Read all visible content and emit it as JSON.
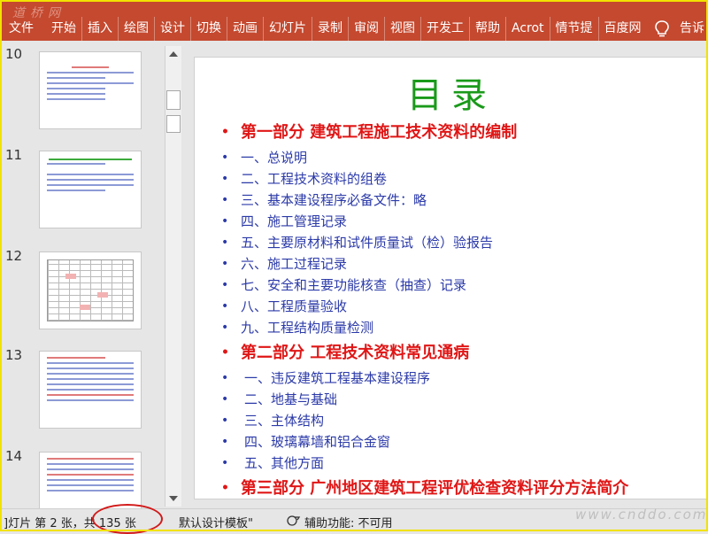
{
  "ribbon": {
    "logo": "道桥网",
    "tabs": [
      "文件",
      "开始",
      "插入",
      "绘图",
      "设计",
      "切换",
      "动画",
      "幻灯片",
      "录制",
      "审阅",
      "视图",
      "开发工",
      "帮助",
      "Acrot",
      "情节提",
      "百度网"
    ],
    "tell_me": "告诉"
  },
  "thumbnails": [
    {
      "number": "10"
    },
    {
      "number": "11"
    },
    {
      "number": "12"
    },
    {
      "number": "13"
    },
    {
      "number": "14"
    }
  ],
  "slide": {
    "title": "目录",
    "sections": [
      {
        "label": "第一部分  建筑工程施工技术资料的编制",
        "items": [
          "一、总说明",
          "二、工程技术资料的组卷",
          "三、基本建设程序必备文件：略",
          "四、施工管理记录",
          "五、主要原材料和试件质量试（检）验报告",
          "六、施工过程记录",
          "七、安全和主要功能核查（抽查）记录",
          "八、工程质量验收",
          "九、工程结构质量检测"
        ]
      },
      {
        "label": "第二部分  工程技术资料常见通病",
        "items": [
          "一、违反建筑工程基本建设程序",
          "二、地基与基础",
          "三、主体结构",
          "四、玻璃幕墙和铝合金窗",
          "五、其他方面"
        ]
      },
      {
        "label": "第三部分  广州地区建筑工程评优检查资料评分方法简介",
        "items": []
      }
    ]
  },
  "status": {
    "slide_info": "]灯片 第 2 张，共 135 张",
    "template": "默认设计模板\"",
    "accessibility": "辅助功能: 不可用"
  },
  "watermark": "www.cnddo.com",
  "colors": {
    "ribbon": "#c4492f",
    "part": "#e01616",
    "item": "#2b3aa8",
    "title": "#1a9a1a",
    "annotation": "#d21a1a"
  }
}
